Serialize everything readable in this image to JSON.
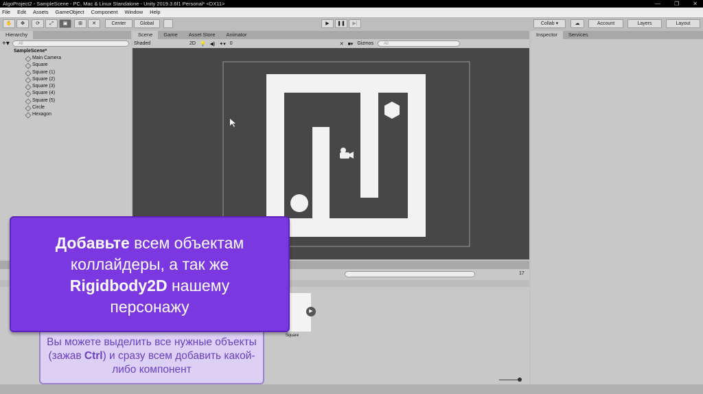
{
  "window": {
    "title": "AlgoProject2 - SampleScene - PC, Mac & Linux Standalone - Unity 2019.3.6f1 Personal* <DX11>",
    "controls": [
      "—",
      "❐",
      "✕"
    ]
  },
  "menu": [
    "File",
    "Edit",
    "Assets",
    "GameObject",
    "Component",
    "Window",
    "Help"
  ],
  "toolbar": {
    "center": "Center",
    "global": "Global",
    "collab": "Collab ▾",
    "account": "Account",
    "layers": "Layers",
    "layout": "Layout"
  },
  "hierarchy": {
    "tab": "Hierarchy",
    "search_placeholder": "All",
    "scene": "SampleScene*",
    "items": [
      "Main Camera",
      "Square",
      "Square (1)",
      "Square (2)",
      "Square (3)",
      "Square (4)",
      "Square (5)",
      "Circle",
      "Hexagon"
    ]
  },
  "scene_tabs": [
    "Scene",
    "Game",
    "Asset Store",
    "Animator"
  ],
  "scene_toolbar": {
    "shading": "Shaded",
    "mode2d": "2D",
    "hidden_count": "0",
    "gizmos": "Gizmos",
    "search_placeholder": "All"
  },
  "inspector_tabs": [
    "Inspector",
    "Services"
  ],
  "project": {
    "asset_name": "Square",
    "count": "17"
  },
  "overlay": {
    "line1_bold": "Добавьте",
    "line1_rest": " всем объектам",
    "line2": "коллайдеры, а так же",
    "line3_bold": "Rigidbody2D",
    "line3_rest": " нашему",
    "line4": "персонажу",
    "hint_pre": "Вы можете выделить все нужные объекты (зажав ",
    "hint_bold": "Ctrl",
    "hint_post": ") и сразу всем добавить какой-либо компонент"
  }
}
